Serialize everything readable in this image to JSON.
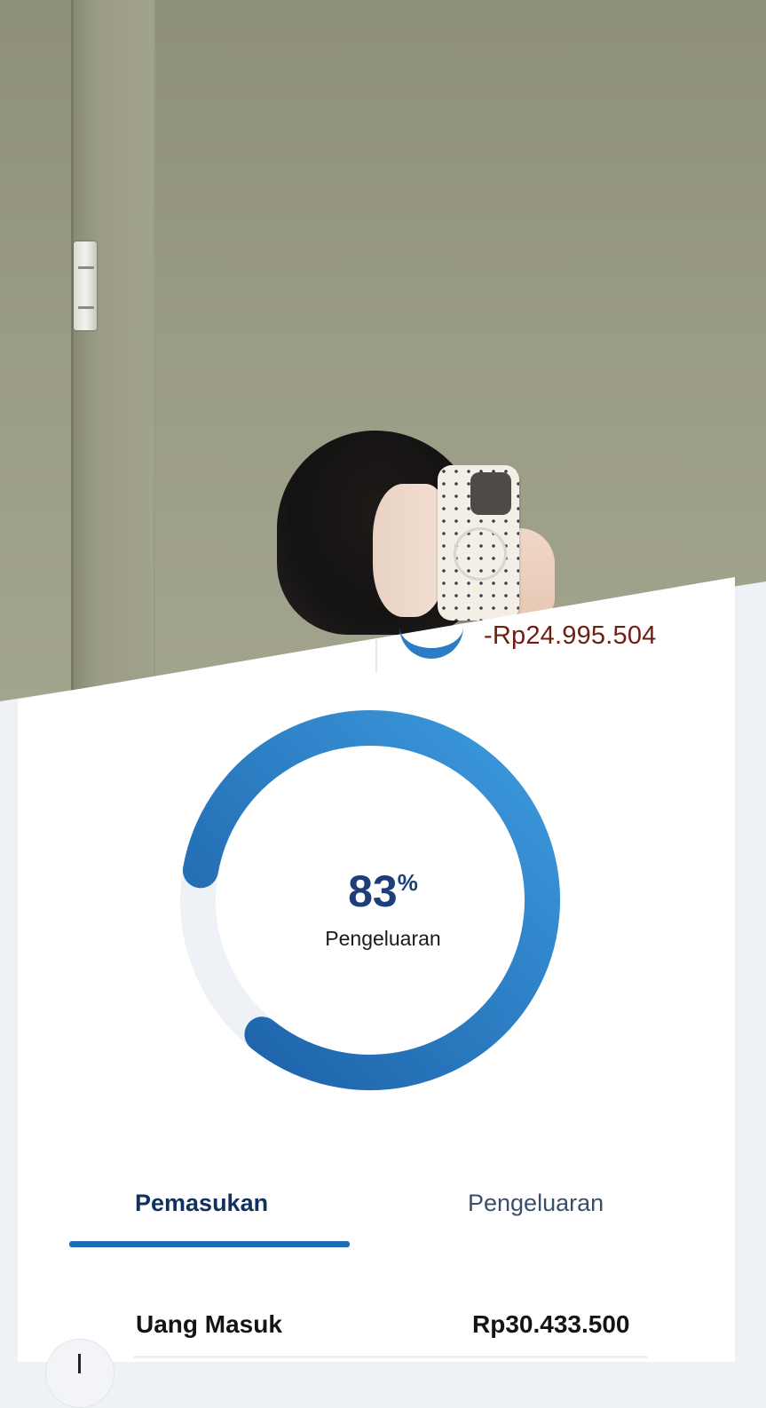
{
  "summary": {
    "top_amount": "-Rp24.995.504"
  },
  "donut": {
    "percent": "83",
    "percent_sign": "%",
    "label": "Pengeluaran",
    "fraction": 0.83,
    "colors": {
      "from": "#1b5fa6",
      "to": "#3d9ade",
      "track": "#eef2f6"
    }
  },
  "tabs": [
    {
      "label": "Pemasukan",
      "active": true
    },
    {
      "label": "Pengeluaran",
      "active": false
    }
  ],
  "rows": [
    {
      "label": "Uang Masuk",
      "value": "Rp30.433.500"
    }
  ]
}
